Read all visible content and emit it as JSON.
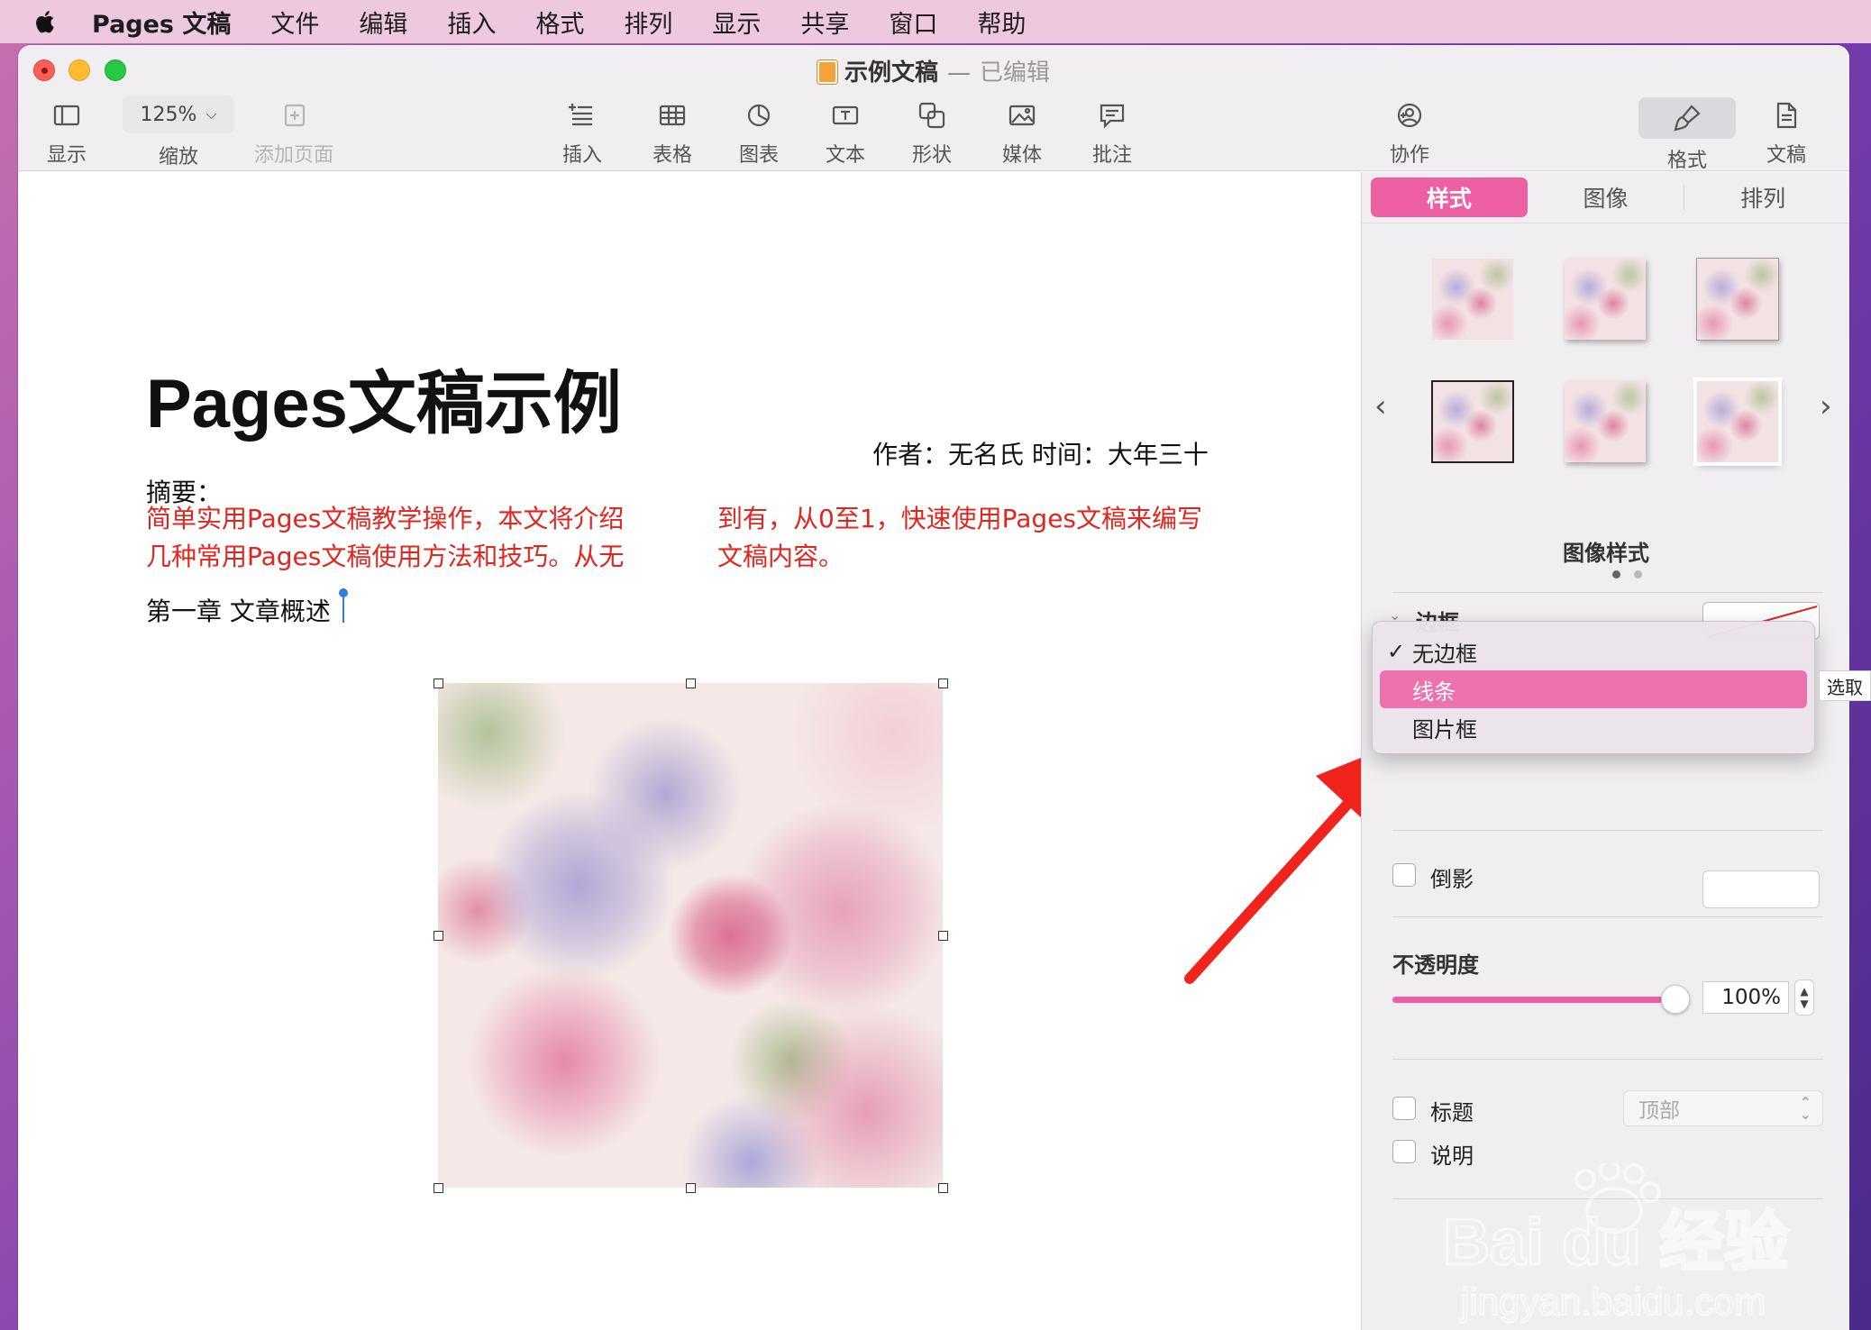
{
  "menubar": {
    "app_name": "Pages 文稿",
    "items": [
      "文件",
      "编辑",
      "插入",
      "格式",
      "排列",
      "显示",
      "共享",
      "窗口",
      "帮助"
    ]
  },
  "window": {
    "doc_name": "示例文稿",
    "separator": "—",
    "status": "已编辑"
  },
  "toolbar": {
    "view_label": "显示",
    "zoom_value": "125%",
    "zoom_label": "缩放",
    "add_page_label": "添加页面",
    "insert_label": "插入",
    "table_label": "表格",
    "chart_label": "图表",
    "text_label": "文本",
    "shape_label": "形状",
    "media_label": "媒体",
    "comment_label": "批注",
    "collab_label": "协作",
    "format_label": "格式",
    "document_label": "文稿"
  },
  "document": {
    "title": "Pages文稿示例",
    "byline": "作者：无名氏 时间：大年三十",
    "abstract_label": "摘要：",
    "red_col1_line1": "简单实用Pages文稿教学操作，本文将介绍",
    "red_col1_line2": "几种常用Pages文稿使用方法和技巧。从无",
    "red_col2_line1": "到有，从0至1，快速使用Pages文稿来编写",
    "red_col2_line2": "文稿内容。",
    "chapter": "第一章 文章概述"
  },
  "sidebar": {
    "tabs": [
      "样式",
      "图像",
      "排列"
    ],
    "image_styles_label": "图像样式",
    "border_label": "边框",
    "reflection_label": "倒影",
    "opacity_label": "不透明度",
    "opacity_value": "100%",
    "opacity": 1.0,
    "title_label": "标题",
    "caption_label": "说明",
    "position_value": "顶部"
  },
  "border_menu": {
    "options": [
      "无边框",
      "线条",
      "图片框"
    ],
    "checked": "无边框",
    "highlighted": "线条",
    "check_mark": "✓"
  },
  "tooltip": "选取",
  "watermark": {
    "logo": "Bai du 经验",
    "url": "jingyan.baidu.com"
  },
  "colors": {
    "accent": "#ee5fa3",
    "red_text": "#e0261f",
    "arrow": "#f0241c"
  }
}
